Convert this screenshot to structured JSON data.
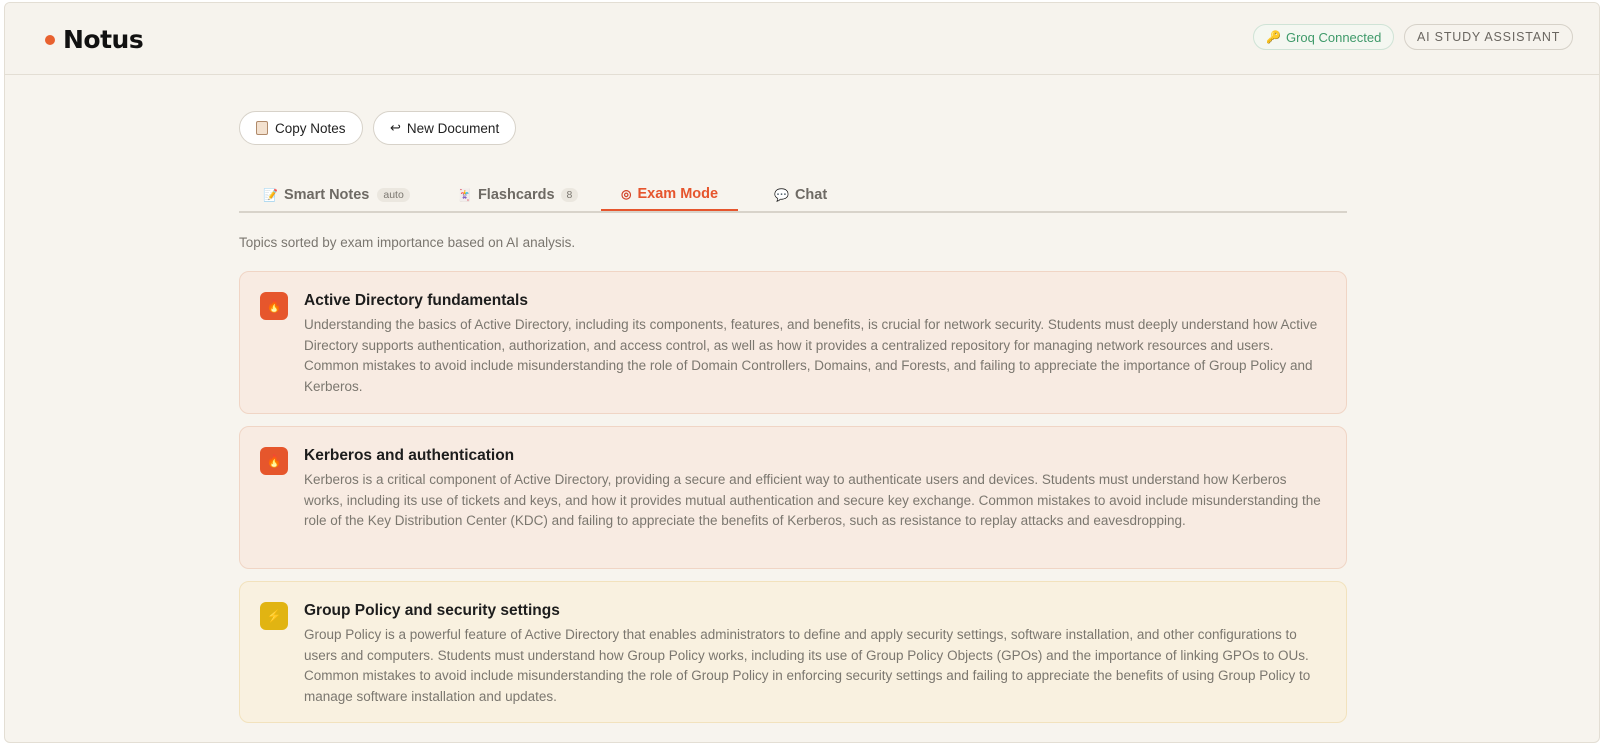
{
  "header": {
    "brand": "Notus",
    "groq_status": "Groq Connected",
    "role_badge": "AI STUDY ASSISTANT"
  },
  "toolbar": {
    "copy_label": "Copy Notes",
    "new_label": "New Document",
    "new_icon": "↩"
  },
  "tabs": [
    {
      "label": "Smart Notes",
      "badge": "auto",
      "icon": "notes-icon"
    },
    {
      "label": "Flashcards",
      "badge": "8",
      "icon": "cards-icon"
    },
    {
      "label": "Exam Mode",
      "icon": "target-icon",
      "active": true
    },
    {
      "label": "Chat",
      "icon": "chat-bubble-icon"
    }
  ],
  "exam": {
    "subtitle": "Topics sorted by exam importance based on AI analysis.",
    "topics": [
      {
        "title": "Active Directory fundamentals",
        "priority": "high",
        "description": "Understanding the basics of Active Directory, including its components, features, and benefits, is crucial for network security. Students must deeply understand how Active Directory supports authentication, authorization, and access control, as well as how it provides a centralized repository for managing network resources and users. Common mistakes to avoid include misunderstanding the role of Domain Controllers, Domains, and Forests, and failing to appreciate the importance of Group Policy and Kerberos."
      },
      {
        "title": "Kerberos and authentication",
        "priority": "high",
        "description": "Kerberos is a critical component of Active Directory, providing a secure and efficient way to authenticate users and devices. Students must understand how Kerberos works, including its use of tickets and keys, and how it provides mutual authentication and secure key exchange. Common mistakes to avoid include misunderstanding the role of the Key Distribution Center (KDC) and failing to appreciate the benefits of Kerberos, such as resistance to replay attacks and eavesdropping."
      },
      {
        "title": "Group Policy and security settings",
        "priority": "medium",
        "description": "Group Policy is a powerful feature of Active Directory that enables administrators to define and apply security settings, software installation, and other configurations to users and computers. Students must understand how Group Policy works, including its use of Group Policy Objects (GPOs) and the importance of linking GPOs to OUs. Common mistakes to avoid include misunderstanding the role of Group Policy in enforcing security settings and failing to appreciate the benefits of using Group Policy to manage software installation and updates."
      }
    ]
  },
  "colors": {
    "accent": "#e6552d",
    "high_priority": "#e6562c",
    "medium_priority": "#e1b412",
    "connected": "#3f9a6a"
  }
}
